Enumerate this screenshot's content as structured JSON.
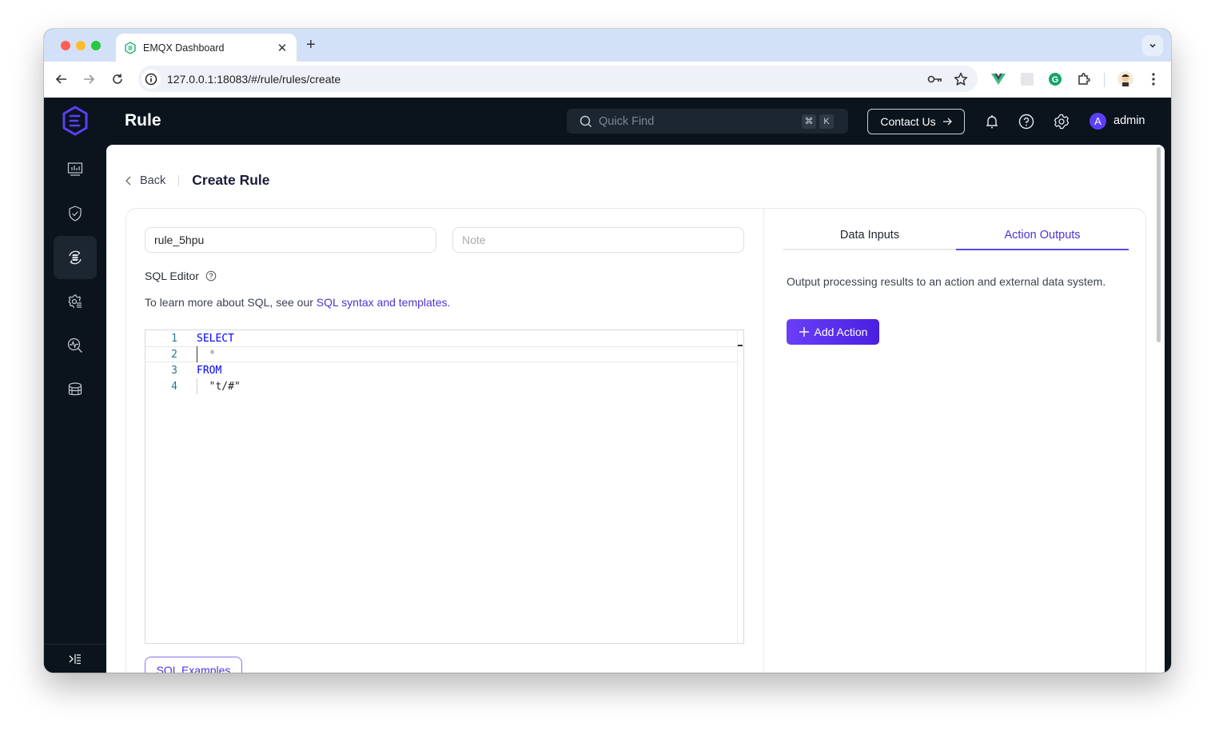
{
  "browser": {
    "tab_title": "EMQX Dashboard",
    "new_tab_label": "+",
    "url": "127.0.0.1:18083/#/rule/rules/create"
  },
  "header": {
    "title": "Rule",
    "search_placeholder": "Quick Find",
    "shortcut_keys": [
      "⌘",
      "K"
    ],
    "contact_label": "Contact Us",
    "user_initial": "A",
    "username": "admin"
  },
  "sidebar": {
    "items": [
      {
        "name": "dashboard",
        "icon": "monitor-chart-icon",
        "active": false
      },
      {
        "name": "access-control",
        "icon": "shield-check-icon",
        "active": false
      },
      {
        "name": "integration",
        "icon": "rule-engine-icon",
        "active": true
      },
      {
        "name": "management",
        "icon": "gear-list-icon",
        "active": false
      },
      {
        "name": "diagnose",
        "icon": "pulse-search-icon",
        "active": false
      },
      {
        "name": "extensions",
        "icon": "layers-icon",
        "active": false
      }
    ]
  },
  "page": {
    "back_label": "Back",
    "heading": "Create Rule",
    "rule_name_value": "rule_5hpu",
    "note_placeholder": "Note",
    "sql_editor_label": "SQL Editor",
    "sql_help_prefix": "To learn more about SQL, see our ",
    "sql_help_link": "SQL syntax and templates.",
    "sql_lines": [
      {
        "num": "1",
        "text": "SELECT",
        "kind": "kw"
      },
      {
        "num": "2",
        "text": "  *",
        "kind": "op"
      },
      {
        "num": "3",
        "text": "FROM",
        "kind": "kw"
      },
      {
        "num": "4",
        "text": "  \"t/#\"",
        "kind": "str"
      }
    ],
    "examples_button_label": "SQL Examples"
  },
  "right_panel": {
    "tabs": [
      {
        "label": "Data Inputs",
        "active": false
      },
      {
        "label": "Action Outputs",
        "active": true
      }
    ],
    "description": "Output processing results to an action and external data system.",
    "add_action_label": "Add Action"
  },
  "colors": {
    "accent": "#4b34d9",
    "app_bg": "#0b131d",
    "primary_button": "#5a2ff0"
  }
}
